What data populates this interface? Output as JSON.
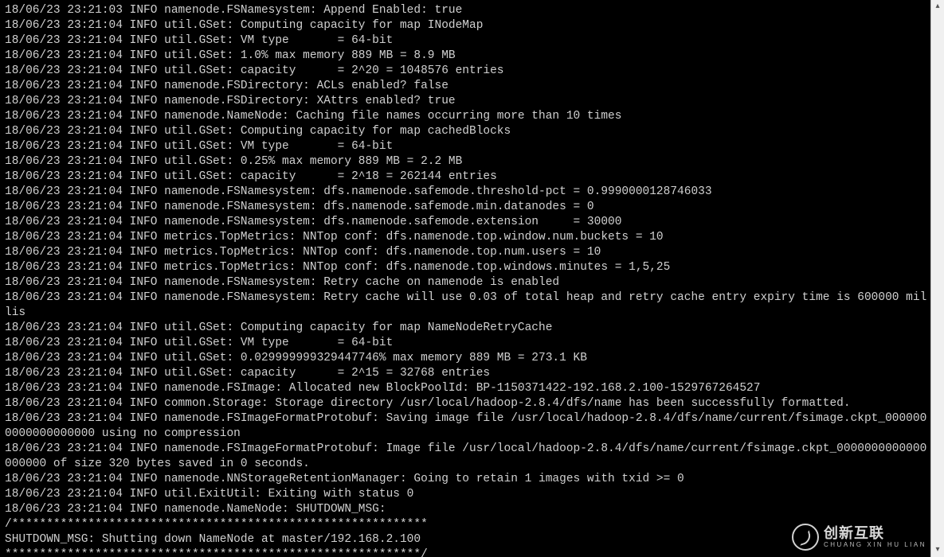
{
  "log": {
    "lines": [
      "18/06/23 23:21:03 INFO namenode.FSNamesystem: Append Enabled: true",
      "18/06/23 23:21:04 INFO util.GSet: Computing capacity for map INodeMap",
      "18/06/23 23:21:04 INFO util.GSet: VM type       = 64-bit",
      "18/06/23 23:21:04 INFO util.GSet: 1.0% max memory 889 MB = 8.9 MB",
      "18/06/23 23:21:04 INFO util.GSet: capacity      = 2^20 = 1048576 entries",
      "18/06/23 23:21:04 INFO namenode.FSDirectory: ACLs enabled? false",
      "18/06/23 23:21:04 INFO namenode.FSDirectory: XAttrs enabled? true",
      "18/06/23 23:21:04 INFO namenode.NameNode: Caching file names occurring more than 10 times",
      "18/06/23 23:21:04 INFO util.GSet: Computing capacity for map cachedBlocks",
      "18/06/23 23:21:04 INFO util.GSet: VM type       = 64-bit",
      "18/06/23 23:21:04 INFO util.GSet: 0.25% max memory 889 MB = 2.2 MB",
      "18/06/23 23:21:04 INFO util.GSet: capacity      = 2^18 = 262144 entries",
      "18/06/23 23:21:04 INFO namenode.FSNamesystem: dfs.namenode.safemode.threshold-pct = 0.9990000128746033",
      "18/06/23 23:21:04 INFO namenode.FSNamesystem: dfs.namenode.safemode.min.datanodes = 0",
      "18/06/23 23:21:04 INFO namenode.FSNamesystem: dfs.namenode.safemode.extension     = 30000",
      "18/06/23 23:21:04 INFO metrics.TopMetrics: NNTop conf: dfs.namenode.top.window.num.buckets = 10",
      "18/06/23 23:21:04 INFO metrics.TopMetrics: NNTop conf: dfs.namenode.top.num.users = 10",
      "18/06/23 23:21:04 INFO metrics.TopMetrics: NNTop conf: dfs.namenode.top.windows.minutes = 1,5,25",
      "18/06/23 23:21:04 INFO namenode.FSNamesystem: Retry cache on namenode is enabled",
      "18/06/23 23:21:04 INFO namenode.FSNamesystem: Retry cache will use 0.03 of total heap and retry cache entry expiry time is 600000 millis",
      "18/06/23 23:21:04 INFO util.GSet: Computing capacity for map NameNodeRetryCache",
      "18/06/23 23:21:04 INFO util.GSet: VM type       = 64-bit",
      "18/06/23 23:21:04 INFO util.GSet: 0.029999999329447746% max memory 889 MB = 273.1 KB",
      "18/06/23 23:21:04 INFO util.GSet: capacity      = 2^15 = 32768 entries",
      "18/06/23 23:21:04 INFO namenode.FSImage: Allocated new BlockPoolId: BP-1150371422-192.168.2.100-1529767264527",
      "18/06/23 23:21:04 INFO common.Storage: Storage directory /usr/local/hadoop-2.8.4/dfs/name has been successfully formatted.",
      "18/06/23 23:21:04 INFO namenode.FSImageFormatProtobuf: Saving image file /usr/local/hadoop-2.8.4/dfs/name/current/fsimage.ckpt_0000000000000000000 using no compression",
      "18/06/23 23:21:04 INFO namenode.FSImageFormatProtobuf: Image file /usr/local/hadoop-2.8.4/dfs/name/current/fsimage.ckpt_0000000000000000000 of size 320 bytes saved in 0 seconds.",
      "18/06/23 23:21:04 INFO namenode.NNStorageRetentionManager: Going to retain 1 images with txid >= 0",
      "18/06/23 23:21:04 INFO util.ExitUtil: Exiting with status 0",
      "18/06/23 23:21:04 INFO namenode.NameNode: SHUTDOWN_MSG: ",
      "/************************************************************",
      "SHUTDOWN_MSG: Shutting down NameNode at master/192.168.2.100",
      "************************************************************/"
    ]
  },
  "scrollbar": {
    "up_glyph": "▴",
    "down_glyph": "▾"
  },
  "watermark": {
    "main": "创新互联",
    "sub": "CHUANG XIN HU LIAN"
  }
}
